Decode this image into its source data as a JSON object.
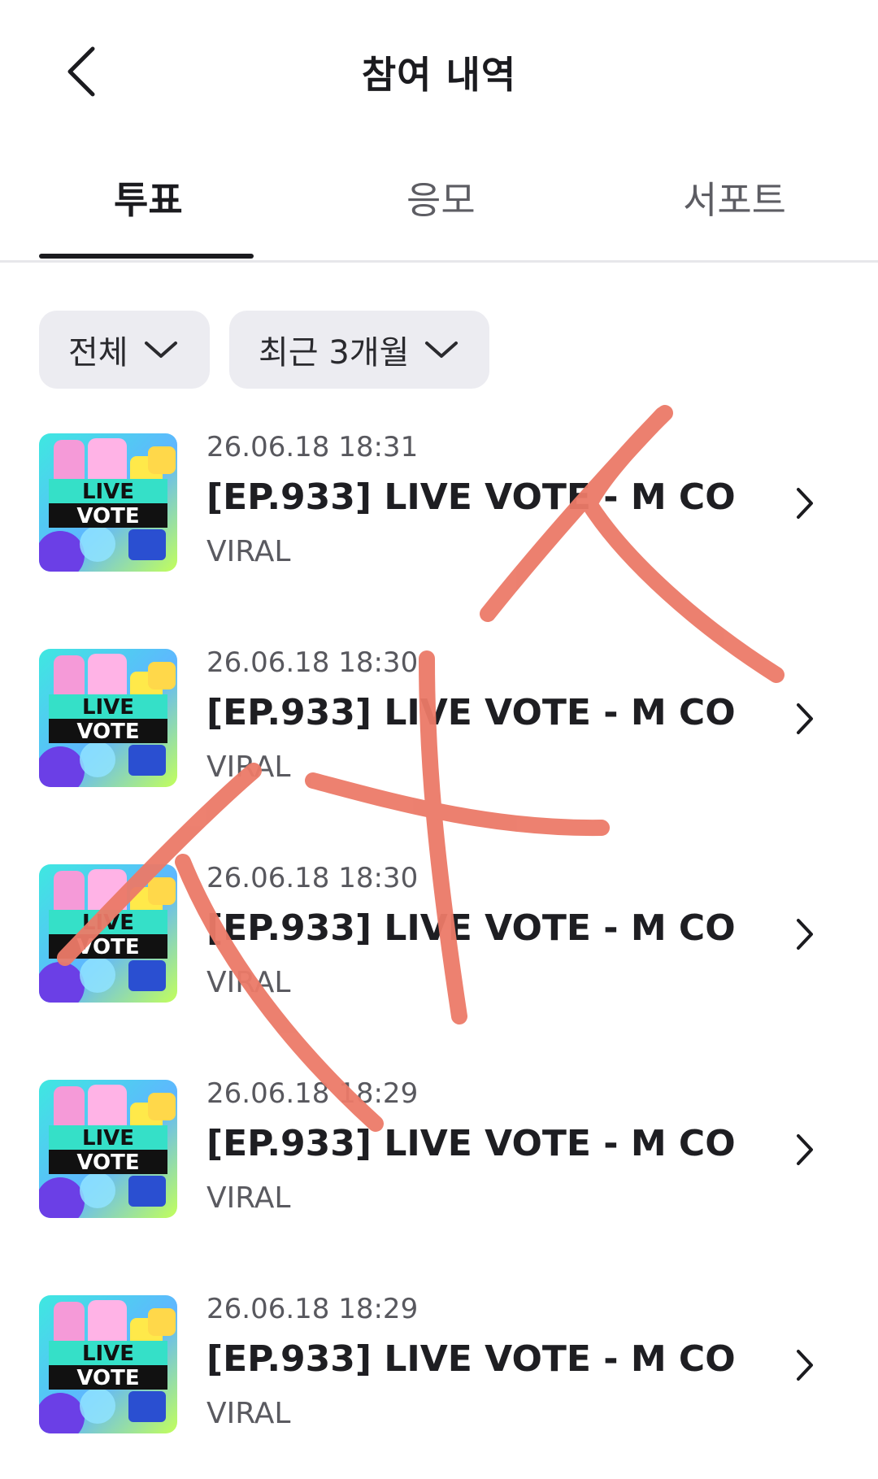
{
  "header": {
    "title": "참여 내역",
    "back_icon": "chevron-left-icon"
  },
  "tabs": [
    {
      "label": "투표",
      "active": true
    },
    {
      "label": "응모",
      "active": false
    },
    {
      "label": "서포트",
      "active": false
    }
  ],
  "filters": {
    "type": {
      "label": "전체",
      "icon": "chevron-down-icon"
    },
    "period": {
      "label": "최근 3개월",
      "icon": "chevron-down-icon"
    }
  },
  "items": [
    {
      "date": "26.06.18 18:31",
      "title": "[EP.933] LIVE VOTE - M CO...",
      "subtitle": "VIRAL",
      "thumb_text": [
        "LIVE",
        "VOTE"
      ]
    },
    {
      "date": "26.06.18 18:30",
      "title": "[EP.933] LIVE VOTE - M CO...",
      "subtitle": "VIRAL",
      "thumb_text": [
        "LIVE",
        "VOTE"
      ]
    },
    {
      "date": "26.06.18 18:30",
      "title": "[EP.933] LIVE VOTE - M CO...",
      "subtitle": "VIRAL",
      "thumb_text": [
        "LIVE",
        "VOTE"
      ]
    },
    {
      "date": "26.06.18 18:29",
      "title": "[EP.933] LIVE VOTE - M CO...",
      "subtitle": "VIRAL",
      "thumb_text": [
        "LIVE",
        "VOTE"
      ]
    },
    {
      "date": "26.06.18 18:29",
      "title": "[EP.933] LIVE VOTE - M CO...",
      "subtitle": "VIRAL",
      "thumb_text": [
        "LIVE",
        "VOTE"
      ]
    }
  ],
  "colors": {
    "text_primary": "#1b1b1f",
    "chip_bg": "#ececf1",
    "annotation": "#ec7a68"
  }
}
